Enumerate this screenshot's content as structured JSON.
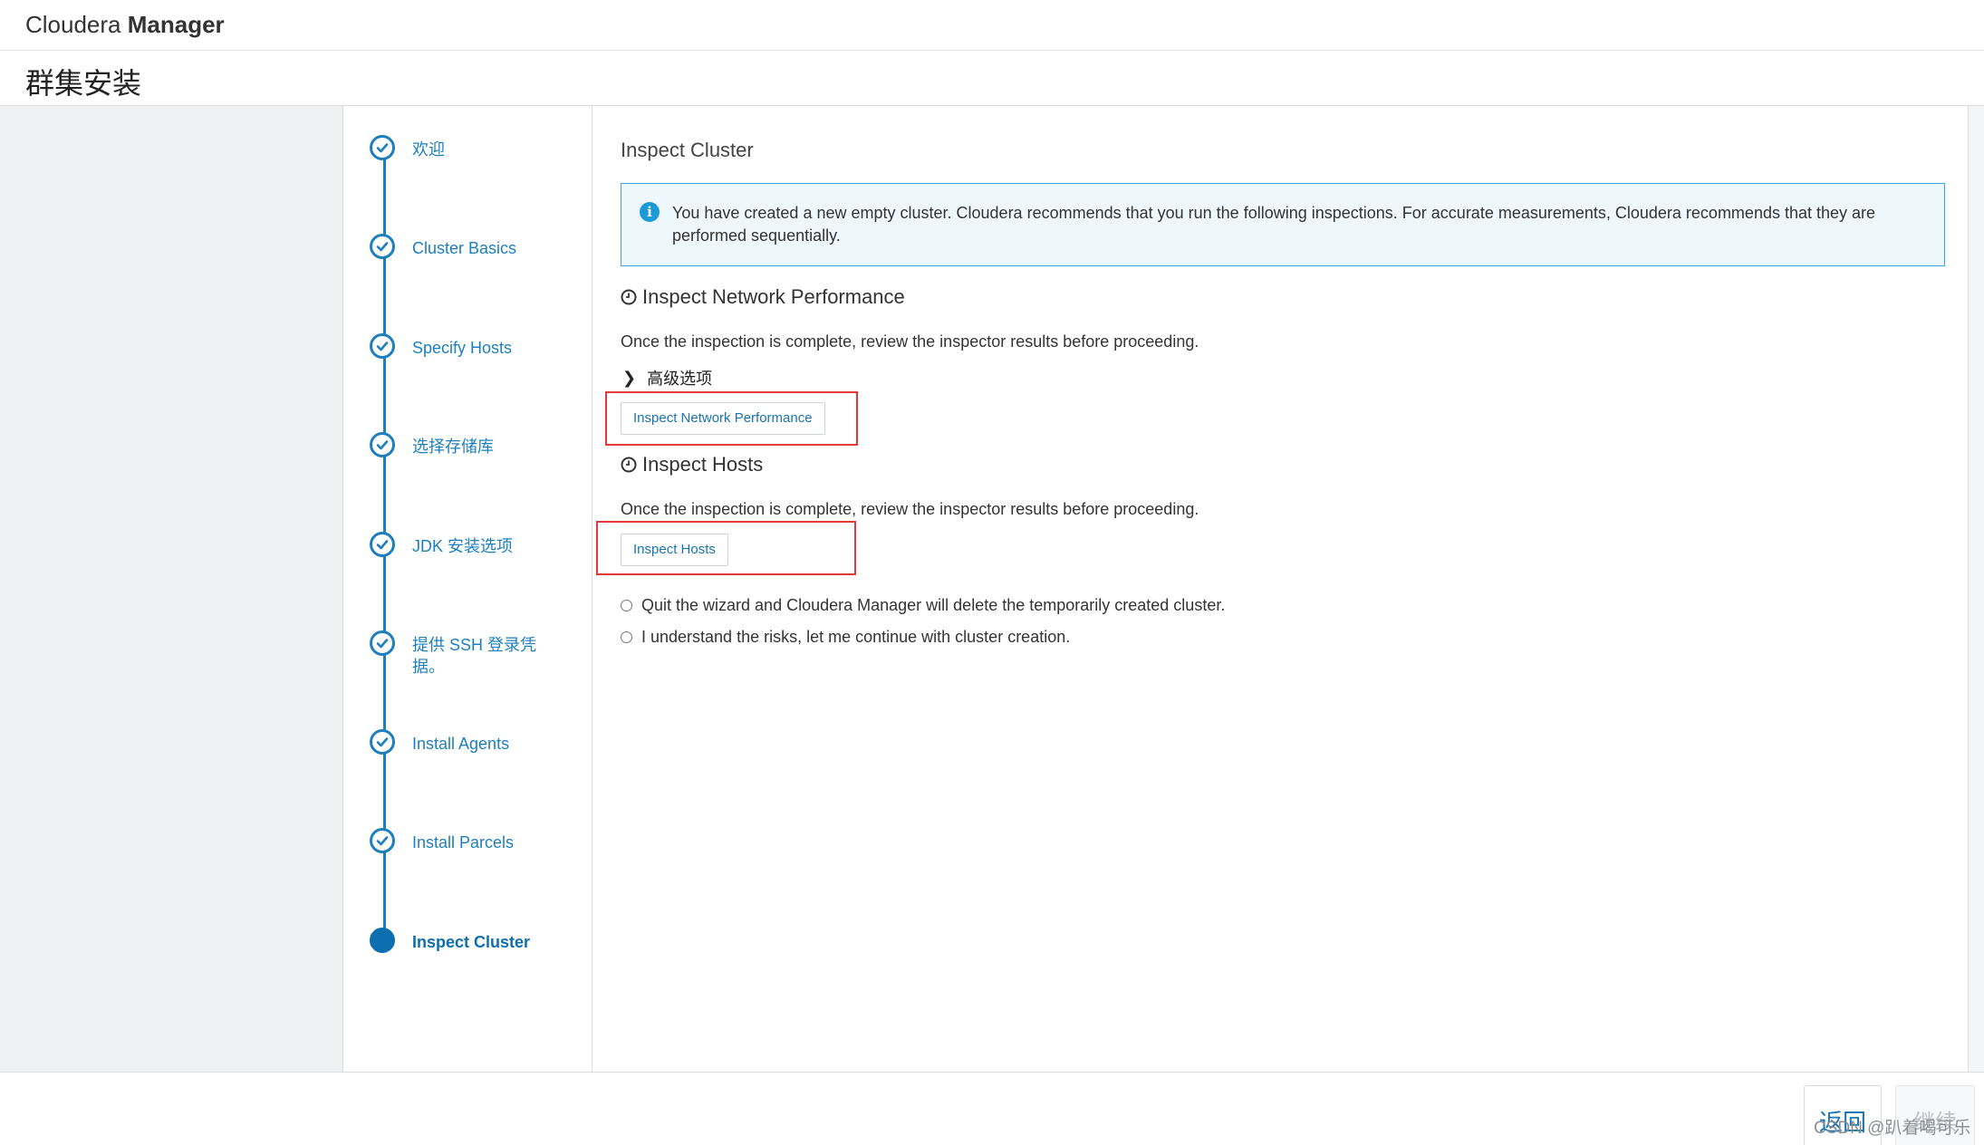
{
  "header": {
    "brand_light": "Cloudera ",
    "brand_bold": "Manager"
  },
  "page": {
    "title": "群集安装"
  },
  "steps": [
    {
      "label": "欢迎",
      "state": "done"
    },
    {
      "label": "Cluster Basics",
      "state": "done"
    },
    {
      "label": "Specify Hosts",
      "state": "done"
    },
    {
      "label": "选择存储库",
      "state": "done"
    },
    {
      "label": "JDK 安装选项",
      "state": "done"
    },
    {
      "label": "提供 SSH 登录凭据。",
      "state": "done"
    },
    {
      "label": "Install Agents",
      "state": "done"
    },
    {
      "label": "Install Parcels",
      "state": "done"
    },
    {
      "label": "Inspect Cluster",
      "state": "current"
    }
  ],
  "main": {
    "title": "Inspect Cluster",
    "info": "You have created a new empty cluster. Cloudera recommends that you run the following inspections. For accurate measurements, Cloudera recommends that they are performed sequentially.",
    "network": {
      "heading": "Inspect Network Performance",
      "text": "Once the inspection is complete, review the inspector results before proceeding.",
      "advanced_label": "高级选项",
      "button": "Inspect Network Performance"
    },
    "hosts": {
      "heading": "Inspect Hosts",
      "text": "Once the inspection is complete, review the inspector results before proceeding.",
      "button": "Inspect Hosts"
    },
    "options": [
      "Quit the wizard and Cloudera Manager will delete the temporarily created cluster.",
      "I understand the risks, let me continue with cluster creation."
    ]
  },
  "footer": {
    "back_label": "返回",
    "next_label": "继续"
  },
  "watermark": "CSDN @趴着喝可乐",
  "colors": {
    "accent": "#1e7fbf",
    "highlight": "#e23a3a",
    "info_border": "#39a7d4"
  }
}
